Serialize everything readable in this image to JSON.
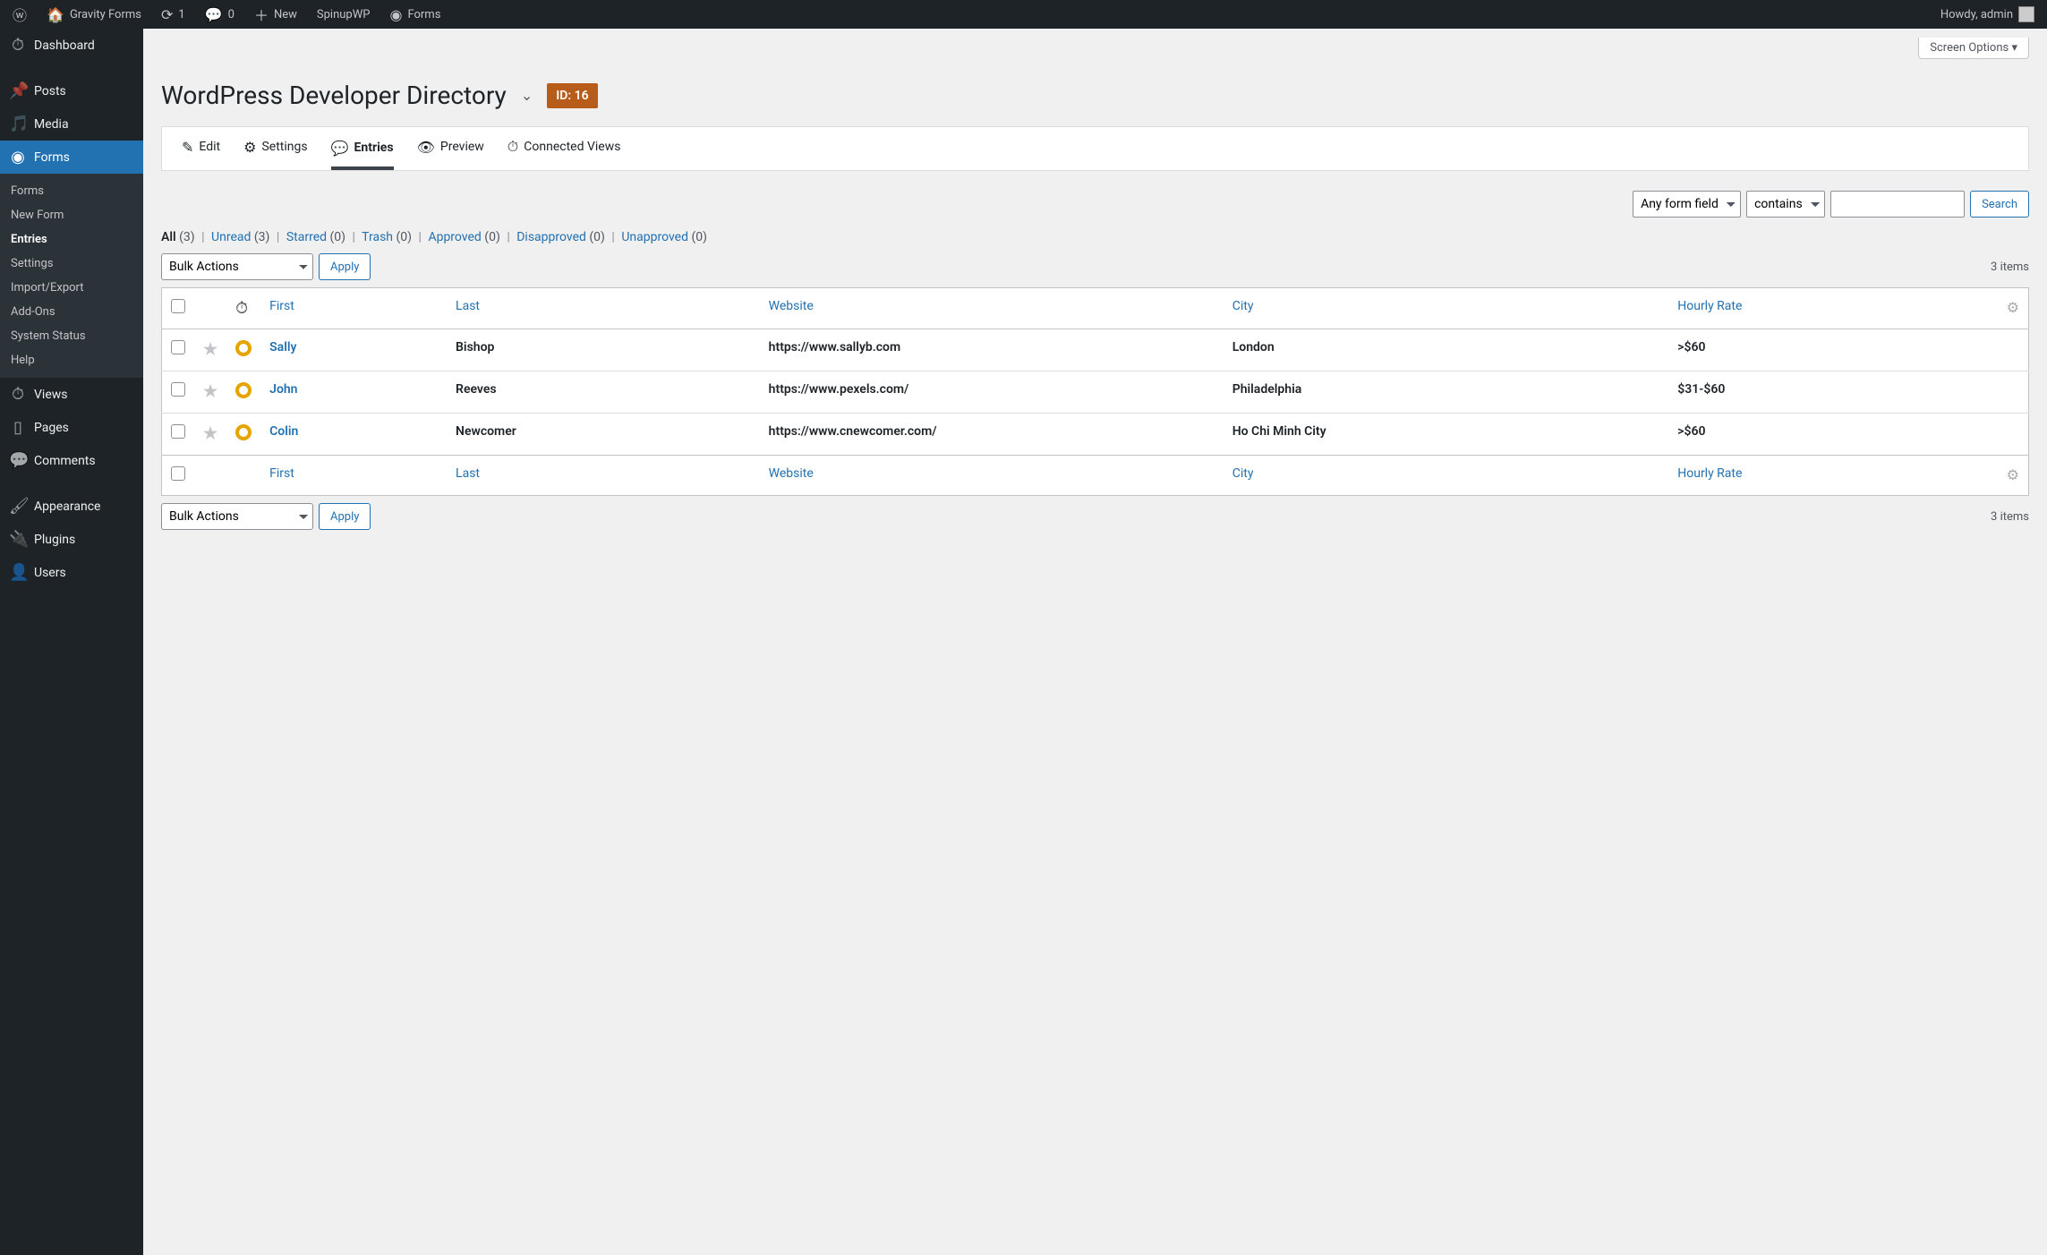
{
  "adminbar": {
    "site": "Gravity Forms",
    "updates": "1",
    "comments": "0",
    "new": "New",
    "spinup": "SpinupWP",
    "forms": "Forms",
    "howdy": "Howdy, admin"
  },
  "sidebar": {
    "dashboard": "Dashboard",
    "posts": "Posts",
    "media": "Media",
    "forms": "Forms",
    "submenu": {
      "forms": "Forms",
      "new_form": "New Form",
      "entries": "Entries",
      "settings": "Settings",
      "import_export": "Import/Export",
      "addons": "Add-Ons",
      "system_status": "System Status",
      "help": "Help"
    },
    "views": "Views",
    "pages": "Pages",
    "comments": "Comments",
    "appearance": "Appearance",
    "plugins": "Plugins",
    "users": "Users"
  },
  "screen_options": "Screen Options",
  "page_title": "WordPress Developer Directory",
  "id_badge": "ID: 16",
  "tabs": {
    "edit": "Edit",
    "settings": "Settings",
    "entries": "Entries",
    "preview": "Preview",
    "connected_views": "Connected Views"
  },
  "search": {
    "field_select": "Any form field",
    "operator": "contains",
    "button": "Search"
  },
  "filters": {
    "all": "All",
    "all_count": "(3)",
    "unread": "Unread",
    "unread_count": "(3)",
    "starred": "Starred",
    "starred_count": "(0)",
    "trash": "Trash",
    "trash_count": "(0)",
    "approved": "Approved",
    "approved_count": "(0)",
    "disapproved": "Disapproved",
    "disapproved_count": "(0)",
    "unapproved": "Unapproved",
    "unapproved_count": "(0)"
  },
  "bulk_actions": "Bulk Actions",
  "apply": "Apply",
  "items_count": "3 items",
  "table": {
    "headers": {
      "first": "First",
      "last": "Last",
      "website": "Website",
      "city": "City",
      "rate": "Hourly Rate"
    },
    "rows": [
      {
        "first": "Sally",
        "last": "Bishop",
        "website": "https://www.sallyb.com",
        "city": "London",
        "rate": ">$60"
      },
      {
        "first": "John",
        "last": "Reeves",
        "website": "https://www.pexels.com/",
        "city": "Philadelphia",
        "rate": "$31-$60"
      },
      {
        "first": "Colin",
        "last": "Newcomer",
        "website": "https://www.cnewcomer.com/",
        "city": "Ho Chi Minh City",
        "rate": ">$60"
      }
    ]
  }
}
